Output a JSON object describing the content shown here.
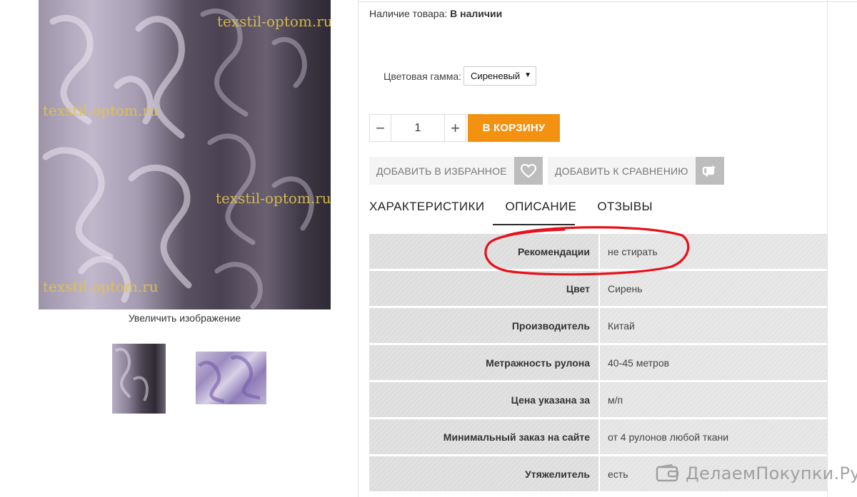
{
  "product_image": {
    "watermarks": [
      "texstil-optom.ru",
      "texstil-optom.ru",
      "texstil-optom.ru",
      "texstil-optom.ru"
    ],
    "zoom_label": "Увеличить изображение"
  },
  "availability": {
    "label": "Наличие товара:",
    "value": "В наличии"
  },
  "color_option": {
    "label": "Цветовая гамма:",
    "selected": "Сиреневый"
  },
  "quantity": {
    "minus": "−",
    "value": "1",
    "plus": "+"
  },
  "cart_button": "В КОРЗИНУ",
  "actions": {
    "favorites": "ДОБАВИТЬ В ИЗБРАННОЕ",
    "compare": "ДОБАВИТЬ К СРАВНЕНИЮ"
  },
  "tabs": [
    {
      "label": "ХАРАКТЕРИСТИКИ"
    },
    {
      "label": "ОПИСАНИЕ"
    },
    {
      "label": "ОТЗЫВЫ"
    }
  ],
  "specs": [
    {
      "key": "Рекомендации",
      "value": "не стирать"
    },
    {
      "key": "Цвет",
      "value": "Сирень"
    },
    {
      "key": "Производитель",
      "value": "Китай"
    },
    {
      "key": "Метражность рулона",
      "value": "40-45 метров"
    },
    {
      "key": "Цена указана за",
      "value": "м/п"
    },
    {
      "key": "Минимальный заказ на сайте",
      "value": "от 4 рулонов любой ткани"
    },
    {
      "key": "Утяжелитель",
      "value": "есть"
    }
  ],
  "brand_watermark": "ДелаемПокупки.Ру",
  "colors": {
    "accent_orange": "#f39211",
    "annotation_red": "#e8101a"
  }
}
